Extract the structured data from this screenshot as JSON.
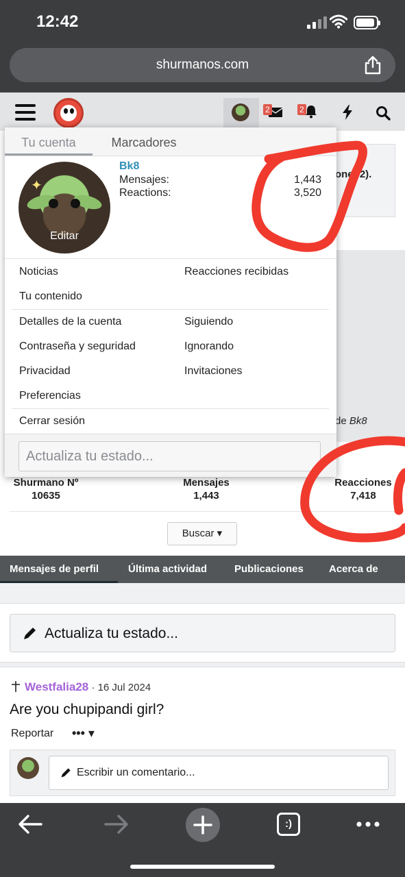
{
  "status_bar": {
    "time": "12:42"
  },
  "browser": {
    "url": "shurmanos.com"
  },
  "header": {
    "messages_badge": "2",
    "alerts_badge": "2"
  },
  "background": {
    "panel_right_text": "one   -2).",
    "by_prefix": "de ",
    "by_user": "Bk8"
  },
  "stats": [
    {
      "label": "Shurmano Nº",
      "value": "10635"
    },
    {
      "label": "Mensajes",
      "value": "1,443"
    },
    {
      "label": "Reacciones",
      "value": "7,418"
    }
  ],
  "buscar_label": "Buscar ▾",
  "profile_tabs": [
    "Mensajes de perfil",
    "Última actividad",
    "Publicaciones",
    "Acerca de"
  ],
  "status_update_placeholder": "Actualiza tu estado...",
  "post": {
    "author": "Westfalia28",
    "date": "· 16 Jul 2024",
    "text": "Are you chupipandi girl?",
    "report": "Reportar",
    "more": "••• ▾",
    "comment_placeholder": "Escribir un comentario..."
  },
  "dropdown": {
    "tabs": [
      "Tu cuenta",
      "Marcadores"
    ],
    "username": "Bk8",
    "avatar_edit": "Editar",
    "stats": [
      {
        "label": "Mensajes:",
        "value": "1,443"
      },
      {
        "label": "Reactions:",
        "value": "3,520"
      }
    ],
    "links_left": [
      "Noticias",
      "Tu contenido",
      "Detalles de la cuenta",
      "Contraseña y seguridad",
      "Privacidad",
      "Preferencias",
      "Cerrar sesión"
    ],
    "links_right": [
      "Reacciones recibidas",
      "Siguiendo",
      "Ignorando",
      "Invitaciones"
    ],
    "status_placeholder": "Actualiza tu estado..."
  },
  "colors": {
    "accent_link": "#2f8fb8",
    "author_purple": "#a463d8",
    "badge_red": "#e05a4e",
    "scribble_red": "#f03a2e"
  },
  "icons": [
    "hamburger-icon",
    "site-logo",
    "envelope-icon",
    "bell-icon",
    "bolt-icon",
    "search-icon",
    "share-icon",
    "back-icon",
    "forward-icon",
    "plus-icon",
    "tabs-icon",
    "more-icon",
    "pencil-icon",
    "cross-icon"
  ]
}
